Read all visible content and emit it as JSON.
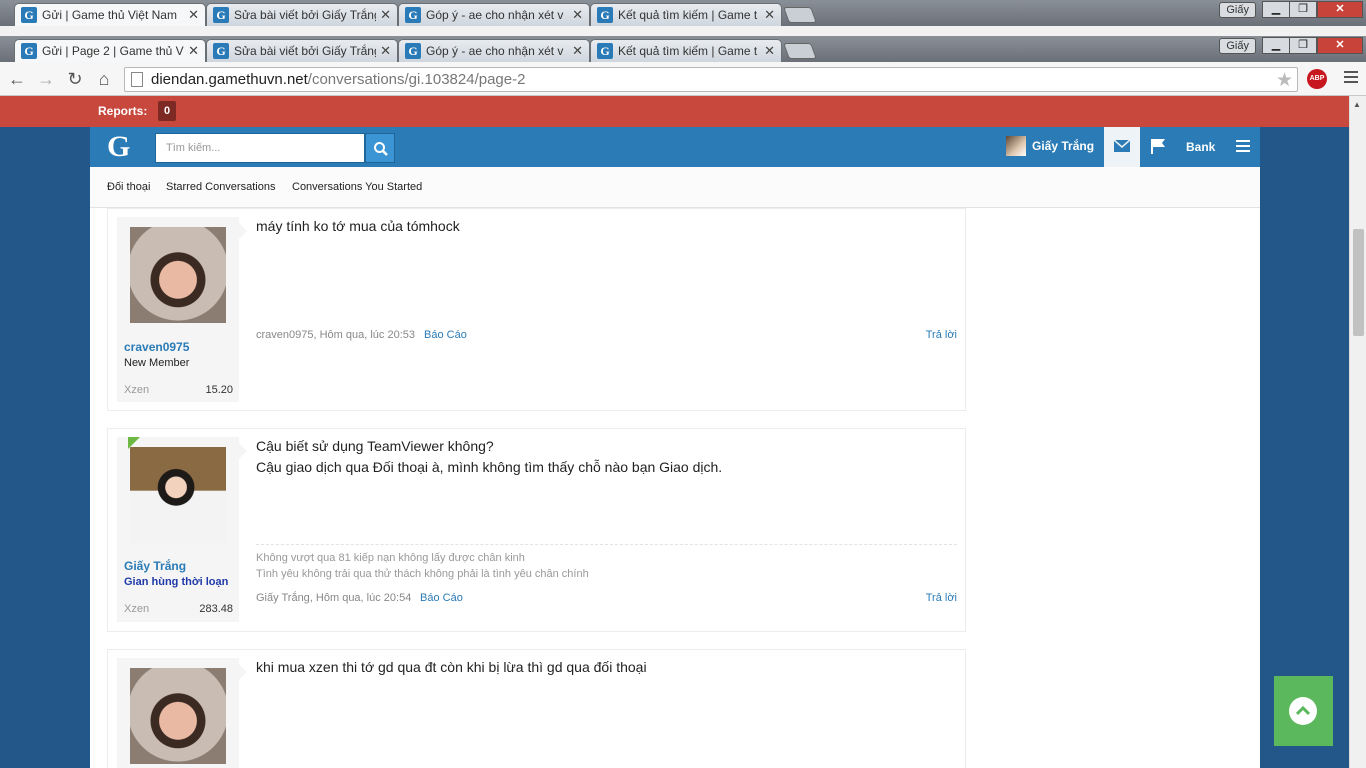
{
  "browser": {
    "tabs_row1": [
      {
        "title": "Gửi | Game thủ Việt Nam",
        "active": true
      },
      {
        "title": "Sửa bài viết bởi Giấy Trắng",
        "active": false
      },
      {
        "title": "Góp ý - ae cho nhận xét v",
        "active": false
      },
      {
        "title": "Kết quả tìm kiếm | Game t",
        "active": false
      }
    ],
    "tabs_row2": [
      {
        "title": "Gửi | Page 2 | Game thủ V",
        "active": true
      },
      {
        "title": "Sửa bài viết bởi Giấy Trắng",
        "active": false
      },
      {
        "title": "Góp ý - ae cho nhận xét v",
        "active": false
      },
      {
        "title": "Kết quả tìm kiếm | Game t",
        "active": false
      }
    ],
    "profile": "Giấy",
    "url_host": "diendan.gamethuvn.net",
    "url_path": "/conversations/gi.103824/page-2",
    "abp_label": "ABP"
  },
  "reports": {
    "label": "Reports:",
    "count": "0"
  },
  "header": {
    "logo": "G",
    "search_placeholder": "Tìm kiếm...",
    "username": "Giấy Trắng",
    "bank": "Bank"
  },
  "subnav": {
    "conversations": "Đối thoại",
    "starred": "Starred Conversations",
    "started": "Conversations You Started"
  },
  "messages": [
    {
      "username": "craven0975",
      "user_title": "New Member",
      "xzen_label": "Xzen",
      "xzen_value": "15.20",
      "body": "máy tính ko tớ mua của tómhock",
      "meta": "craven0975, Hôm qua, lúc 20:53",
      "report": "Báo Cáo",
      "reply": "Trả lời"
    },
    {
      "username": "Giấy Trắng",
      "user_title": "Gian hùng thời loạn",
      "xzen_label": "Xzen",
      "xzen_value": "283.48",
      "body_line1": "Cậu biết sử dụng TeamViewer không?",
      "body_line2": "Cậu giao dịch qua Đối thoại à, mình không tìm thấy chỗ nào bạn Giao dịch.",
      "sig_line1": "Không vượt qua 81 kiếp nạn không lấy được chân kinh",
      "sig_line2": "Tình yêu không trải qua thử thách không phải là tình yêu chân chính",
      "meta": "Giấy Trắng, Hôm qua, lúc 20:54",
      "report": "Báo Cáo",
      "reply": "Trả lời"
    },
    {
      "body": "khi mua xzen thi tớ gd qua đt còn khi bị lừa thì gd qua đối thoại"
    }
  ],
  "colors": {
    "accent": "#2a7bb6",
    "reports_bar": "#c8483e",
    "background": "#23578a",
    "scroll_top_button": "#5cb85c"
  },
  "icons": [
    "search-icon",
    "envelope-icon",
    "flag-icon",
    "hamburger-icon",
    "chevron-up-icon",
    "star-icon",
    "back-icon",
    "forward-icon",
    "reload-icon",
    "home-icon"
  ]
}
